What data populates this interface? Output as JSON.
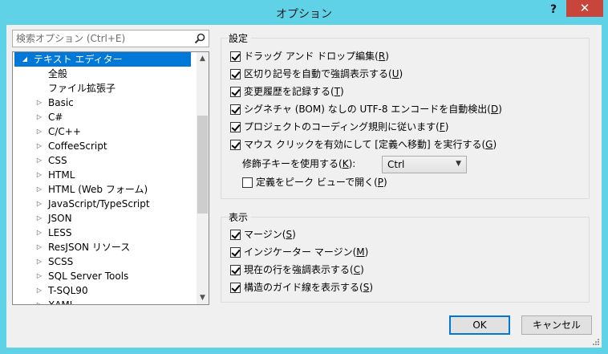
{
  "window": {
    "title": "オプション",
    "help": "?",
    "close": "✕"
  },
  "search": {
    "placeholder": "検索オプション (Ctrl+E)"
  },
  "tree": {
    "items": [
      {
        "label": "テキスト エディター",
        "arrow": "◢",
        "selected": true
      },
      {
        "label": "全般",
        "arrow": ""
      },
      {
        "label": "ファイル拡張子",
        "arrow": ""
      },
      {
        "label": "Basic",
        "arrow": "▷"
      },
      {
        "label": "C#",
        "arrow": "▷"
      },
      {
        "label": "C/C++",
        "arrow": "▷"
      },
      {
        "label": "CoffeeScript",
        "arrow": "▷"
      },
      {
        "label": "CSS",
        "arrow": "▷"
      },
      {
        "label": "HTML",
        "arrow": "▷"
      },
      {
        "label": "HTML (Web フォーム)",
        "arrow": "▷"
      },
      {
        "label": "JavaScript/TypeScript",
        "arrow": "▷"
      },
      {
        "label": "JSON",
        "arrow": "▷"
      },
      {
        "label": "LESS",
        "arrow": "▷"
      },
      {
        "label": "ResJSON リソース",
        "arrow": "▷"
      },
      {
        "label": "SCSS",
        "arrow": "▷"
      },
      {
        "label": "SQL Server Tools",
        "arrow": "▷"
      },
      {
        "label": "T-SQL90",
        "arrow": "▷"
      },
      {
        "label": "XAML",
        "arrow": "▷"
      }
    ]
  },
  "settings": {
    "title": "設定",
    "options": [
      {
        "text": "ドラッグ アンド ドロップ編集(",
        "key": "R",
        "close": ")",
        "checked": true
      },
      {
        "text": "区切り記号を自動で強調表示する(",
        "key": "U",
        "close": ")",
        "checked": true
      },
      {
        "text": "変更履歴を記録する(",
        "key": "T",
        "close": ")",
        "checked": true
      },
      {
        "text": "シグネチャ (BOM) なしの UTF-8 エンコードを自動検出(",
        "key": "D",
        "close": ")",
        "checked": true
      },
      {
        "text": "プロジェクトのコーディング規則に従います(",
        "key": "F",
        "close": ")",
        "checked": true
      },
      {
        "text": "マウス クリックを有効にして [定義へ移動] を実行する(",
        "key": "G",
        "close": ")",
        "checked": true
      }
    ],
    "modifier_label": "修飾子キーを使用する(",
    "modifier_key": "K",
    "modifier_close": "):",
    "modifier_value": "Ctrl",
    "peek": {
      "text": "定義をピーク ビューで開く(",
      "key": "P",
      "close": ")",
      "checked": false
    }
  },
  "display": {
    "title": "表示",
    "options": [
      {
        "text": "マージン(",
        "key": "S",
        "close": ")",
        "checked": true
      },
      {
        "text": "インジケーター マージン(",
        "key": "M",
        "close": ")",
        "checked": true
      },
      {
        "text": "現在の行を強調表示する(",
        "key": "C",
        "close": ")",
        "checked": true
      },
      {
        "text": "構造のガイド線を表示する(",
        "key": "S",
        "close": ")",
        "checked": true
      }
    ]
  },
  "buttons": {
    "ok": "OK",
    "cancel": "キャンセル"
  },
  "colors": {
    "frame": "#5fd2e8",
    "selection": "#0078d7",
    "close": "#c7453a"
  }
}
